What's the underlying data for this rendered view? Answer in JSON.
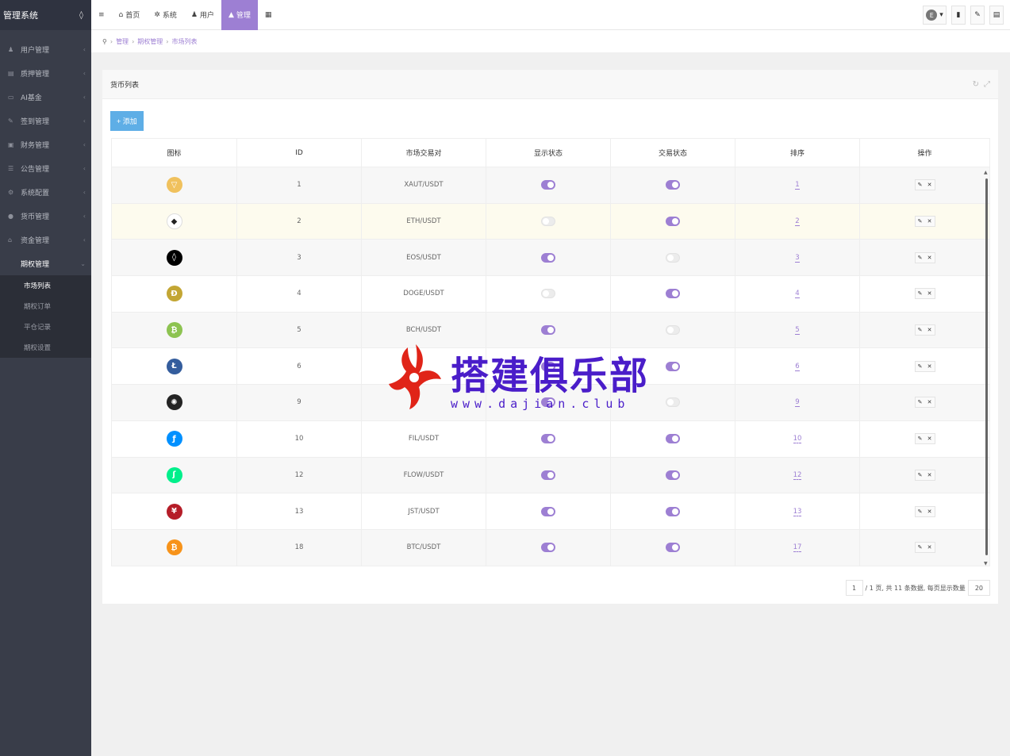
{
  "sidebar": {
    "brand": "管理系统",
    "menu": [
      {
        "icon": "user-icon",
        "glyph": "♟",
        "label": "用户管理"
      },
      {
        "icon": "list-icon",
        "glyph": "▤",
        "label": "质押管理"
      },
      {
        "icon": "monitor-icon",
        "glyph": "▭",
        "label": "AI基金"
      },
      {
        "icon": "edit-icon",
        "glyph": "✎",
        "label": "签到管理"
      },
      {
        "icon": "card-icon",
        "glyph": "▣",
        "label": "财务管理"
      },
      {
        "icon": "notice-icon",
        "glyph": "☰",
        "label": "公告管理"
      },
      {
        "icon": "cogs-icon",
        "glyph": "⚙",
        "label": "系统配置"
      },
      {
        "icon": "coin-icon",
        "glyph": "●",
        "label": "货币管理"
      },
      {
        "icon": "bank-icon",
        "glyph": "⌂",
        "label": "资金管理"
      },
      {
        "icon": "",
        "glyph": "",
        "label": "期权管理"
      }
    ],
    "submenu": [
      "市场列表",
      "期权订单",
      "平仓记录",
      "期权设置"
    ]
  },
  "topbar": {
    "menu_glyph": "≡",
    "items": [
      {
        "icon": "home-icon",
        "glyph": "⌂",
        "label": "首页"
      },
      {
        "icon": "gear-icon",
        "glyph": "✲",
        "label": "系统"
      },
      {
        "icon": "user-icon",
        "glyph": "♟",
        "label": "用户"
      },
      {
        "icon": "lock-icon",
        "glyph": "▲",
        "label": "管理"
      }
    ],
    "grid_glyph": "▦",
    "lang_glyph": "E",
    "caret": "▾",
    "trash_glyph": "▮",
    "edit_glyph": "✎",
    "list_glyph": "▤"
  },
  "breadcrumb": {
    "pin": "⚲",
    "sep": "›",
    "items": [
      "管理",
      "期权管理",
      "市场列表"
    ]
  },
  "card": {
    "title": "货币列表",
    "refresh_glyph": "↻",
    "expand_glyph": "⤢",
    "add_label": "+ 添加"
  },
  "table": {
    "headers": [
      "图标",
      "ID",
      "市场交易对",
      "显示状态",
      "交易状态",
      "排序",
      "操作"
    ],
    "op_edit": "✎",
    "op_delete": "✕",
    "rows": [
      {
        "coin": "xaut-icon",
        "color": "#f0c15d",
        "glyph": "▽",
        "id": "1",
        "pair": "XAUT/USDT",
        "show": true,
        "trade": true,
        "sort": "1"
      },
      {
        "coin": "eth-icon",
        "color": "#ffffff",
        "glyph": "◆",
        "id": "2",
        "pair": "ETH/USDT",
        "show": false,
        "trade": true,
        "sort": "2"
      },
      {
        "coin": "eos-icon",
        "color": "#000000",
        "glyph": "◊",
        "id": "3",
        "pair": "EOS/USDT",
        "show": true,
        "trade": false,
        "sort": "3"
      },
      {
        "coin": "doge-icon",
        "color": "#c3a634",
        "glyph": "Đ",
        "id": "4",
        "pair": "DOGE/USDT",
        "show": false,
        "trade": true,
        "sort": "4"
      },
      {
        "coin": "bch-icon",
        "color": "#8dc351",
        "glyph": "₿",
        "id": "5",
        "pair": "BCH/USDT",
        "show": true,
        "trade": false,
        "sort": "5"
      },
      {
        "coin": "ltc-icon",
        "color": "#345d9d",
        "glyph": "Ł",
        "id": "6",
        "pair": "",
        "show": true,
        "trade": true,
        "sort": "6"
      },
      {
        "coin": "iota-icon",
        "color": "#242424",
        "glyph": "✺",
        "id": "9",
        "pair": "",
        "show": true,
        "trade": false,
        "sort": "9"
      },
      {
        "coin": "fil-icon",
        "color": "#0090ff",
        "glyph": "ƒ",
        "id": "10",
        "pair": "FIL/USDT",
        "show": true,
        "trade": true,
        "sort": "10"
      },
      {
        "coin": "flow-icon",
        "color": "#00ef8b",
        "glyph": "ʃ",
        "id": "12",
        "pair": "FLOW/USDT",
        "show": true,
        "trade": true,
        "sort": "12"
      },
      {
        "coin": "jst-icon",
        "color": "#b51d28",
        "glyph": "¥",
        "id": "13",
        "pair": "JST/USDT",
        "show": true,
        "trade": true,
        "sort": "13"
      },
      {
        "coin": "btc-icon",
        "color": "#f7931a",
        "glyph": "₿",
        "id": "18",
        "pair": "BTC/USDT",
        "show": true,
        "trade": true,
        "sort": "17"
      }
    ]
  },
  "pager": {
    "current": "1",
    "summary": "/ 1 页, 共 11 条数据, 每页显示数量",
    "per_page": "20"
  },
  "watermark": {
    "title": "搭建俱乐部",
    "url": "www.dajian.club"
  }
}
